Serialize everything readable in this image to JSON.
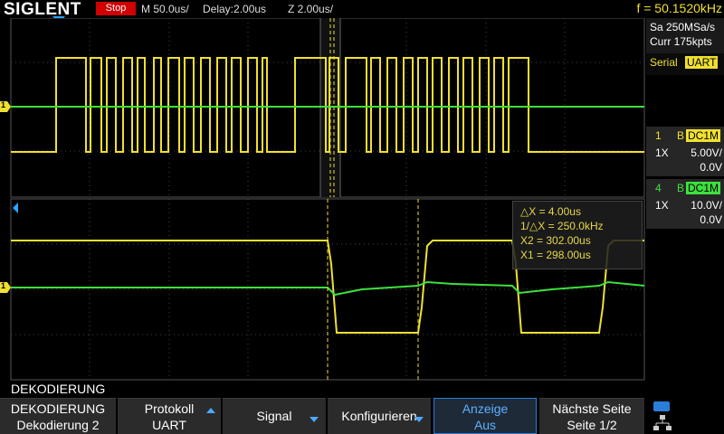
{
  "topbar": {
    "brand": "SIGLENT",
    "run_state": "Stop",
    "timebase": "M 50.0us/",
    "delay": "Delay:2.00us",
    "zoom": "Z 2.00us/",
    "frequency": "f = 50.1520kHz"
  },
  "acquisition": {
    "sample_rate": "Sa 250MSa/s",
    "memory": "Curr 175kpts"
  },
  "decode": {
    "label": "Serial",
    "protocol": "UART"
  },
  "channels": [
    {
      "number": "1",
      "coupling_icon": "B",
      "coupling": "DC1M",
      "probe": "1X",
      "scale": "5.00V/",
      "offset": "0.0V",
      "color": "#f0e030"
    },
    {
      "number": "4",
      "coupling_icon": "B",
      "coupling": "DC1M",
      "probe": "1X",
      "scale": "10.0V/",
      "offset": "0.0V",
      "color": "#3de03d"
    }
  ],
  "cursor_readout": {
    "delta_x": "△X = 4.00us",
    "inv_delta_x": "1/△X = 250.0kHz",
    "x2": "X2 = 302.00us",
    "x1": "X1 = 298.00us"
  },
  "channel_markers": {
    "main_ch": "1",
    "zoom_ch": "1"
  },
  "menu": {
    "title": "DEKODIERUNG",
    "softkeys": [
      {
        "line1": "DEKODIERUNG",
        "line2": "Dekodierung 2"
      },
      {
        "line1": "Protokoll",
        "line2": "UART"
      },
      {
        "line1": "Signal",
        "line2": ""
      },
      {
        "line1": "Konfigurieren",
        "line2": ""
      },
      {
        "line1": "Anzeige",
        "line2": "Aus"
      },
      {
        "line1": "Nächste Seite",
        "line2": "Seite 1/2"
      }
    ]
  },
  "colors": {
    "ch1": "#f0e030",
    "ch4": "#3de03d",
    "accent": "#2aa6ff",
    "stop": "#d00000"
  }
}
